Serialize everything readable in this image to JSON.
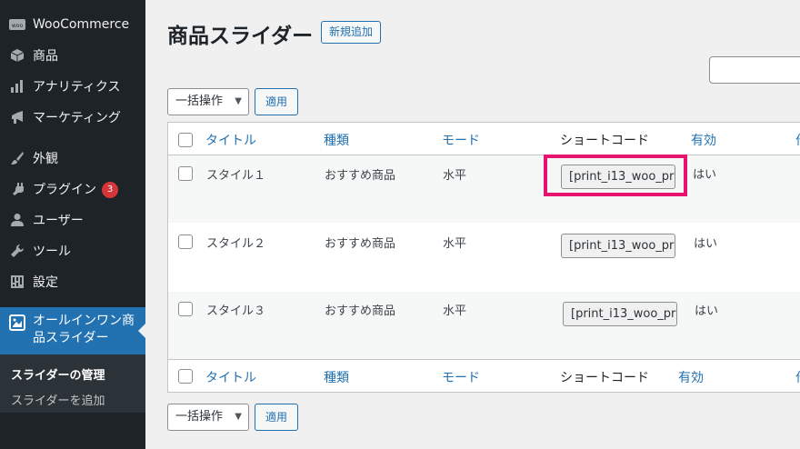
{
  "sidebar": {
    "items": [
      {
        "label": "WooCommerce",
        "icon": "woo-icon"
      },
      {
        "label": "商品",
        "icon": "box-icon"
      },
      {
        "label": "アナリティクス",
        "icon": "bar-chart-icon"
      },
      {
        "label": "マーケティング",
        "icon": "megaphone-icon"
      },
      {
        "label": "外観",
        "icon": "brush-icon"
      },
      {
        "label": "プラグイン",
        "icon": "plugin-icon",
        "badge": "3"
      },
      {
        "label": "ユーザー",
        "icon": "user-icon"
      },
      {
        "label": "ツール",
        "icon": "wrench-icon"
      },
      {
        "label": "設定",
        "icon": "settings-icon"
      }
    ],
    "current": {
      "line1": "オールインワン商",
      "line2": "品スライダー",
      "icon": "slider-icon"
    },
    "submenu": [
      {
        "label": "スライダーの管理"
      },
      {
        "label": "スライダーを追加"
      }
    ],
    "colors": {
      "background": "#1d2327",
      "current": "#2271b1",
      "badge": "#d63638"
    }
  },
  "page": {
    "title": "商品スライダー",
    "add_new": "新規追加"
  },
  "bulk": {
    "select_label": "一括操作",
    "apply_label": "適用"
  },
  "table": {
    "headers": {
      "title": "タイトル",
      "type": "種類",
      "mode": "モード",
      "shortcode": "ショートコード",
      "enabled": "有効",
      "cut": "作"
    },
    "rows": [
      {
        "title": "スタイル１",
        "type": "おすすめ商品",
        "mode": "水平",
        "shortcode": "[print_i13_woo_pr",
        "enabled": "はい"
      },
      {
        "title": "スタイル２",
        "type": "おすすめ商品",
        "mode": "水平",
        "shortcode": "[print_i13_woo_pr",
        "enabled": "はい"
      },
      {
        "title": "スタイル３",
        "type": "おすすめ商品",
        "mode": "水平",
        "shortcode": "[print_i13_woo_pr",
        "enabled": "はい"
      }
    ]
  },
  "highlight_color": "#e6136f"
}
